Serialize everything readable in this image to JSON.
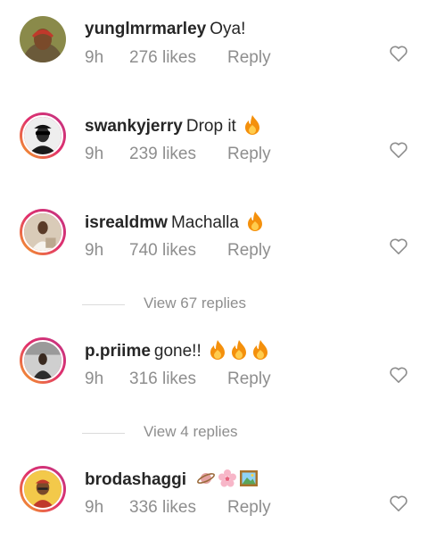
{
  "comments": [
    {
      "username": "yunglmrmarley",
      "text": "Oya!",
      "time": "9h",
      "likes": "276 likes",
      "reply": "Reply",
      "avatar_icon": "avatar-photo-red-cap",
      "emojis": []
    },
    {
      "username": "swankyjerry",
      "text": "Drop it",
      "time": "9h",
      "likes": "239 likes",
      "reply": "Reply",
      "avatar_icon": "avatar-photo-sunglasses",
      "emojis": [
        "fire"
      ]
    },
    {
      "username": "isrealdmw",
      "text": "Machalla",
      "time": "9h",
      "likes": "740 likes",
      "reply": "Reply",
      "avatar_icon": "avatar-photo-white-outfit",
      "emojis": [
        "fire"
      ]
    },
    {
      "username": "p.priime",
      "text": "gone!!",
      "time": "9h",
      "likes": "316 likes",
      "reply": "Reply",
      "avatar_icon": "avatar-photo-dark",
      "emojis": [
        "fire",
        "fire",
        "fire"
      ]
    },
    {
      "username": "brodashaggi",
      "text": "",
      "time": "9h",
      "likes": "336 likes",
      "reply": "Reply",
      "avatar_icon": "avatar-photo-cartoon",
      "emojis": [
        "ringed-planet",
        "cherry-blossom",
        "framed-picture"
      ]
    }
  ],
  "view_replies": [
    {
      "label": "View 67 replies"
    },
    {
      "label": "View 4 replies"
    }
  ],
  "colors": {
    "text": "#262626",
    "muted": "#8e8e8e",
    "fire": "#f4900c"
  }
}
